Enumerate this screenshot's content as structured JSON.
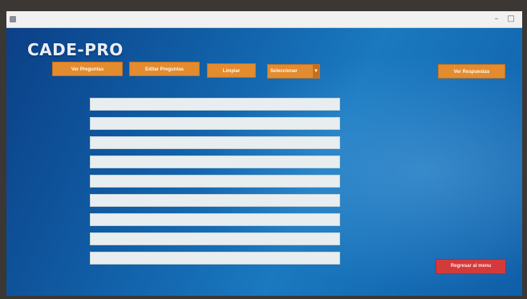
{
  "window": {
    "minimize_glyph": "–",
    "maximize_glyph": "□"
  },
  "app": {
    "title": "CADE-PRO"
  },
  "toolbar": {
    "ver_preguntas": "Ver Preguntas",
    "editar_preguntas": "Editar Preguntas",
    "limpiar": "Limpiar",
    "seleccionar": "Seleccionar",
    "ver_respuestas": "Ver Respuestas"
  },
  "fields": [
    "",
    "",
    "",
    "",
    "",
    "",
    "",
    "",
    ""
  ],
  "footer": {
    "back_button": "Regresar al menu"
  },
  "colors": {
    "accent_orange": "#e38b2f",
    "danger_red": "#d53a3a",
    "background_blue": "#1160a8"
  },
  "icons": {
    "dropdown": "chevron-down-icon",
    "window_icon": "app-icon"
  }
}
